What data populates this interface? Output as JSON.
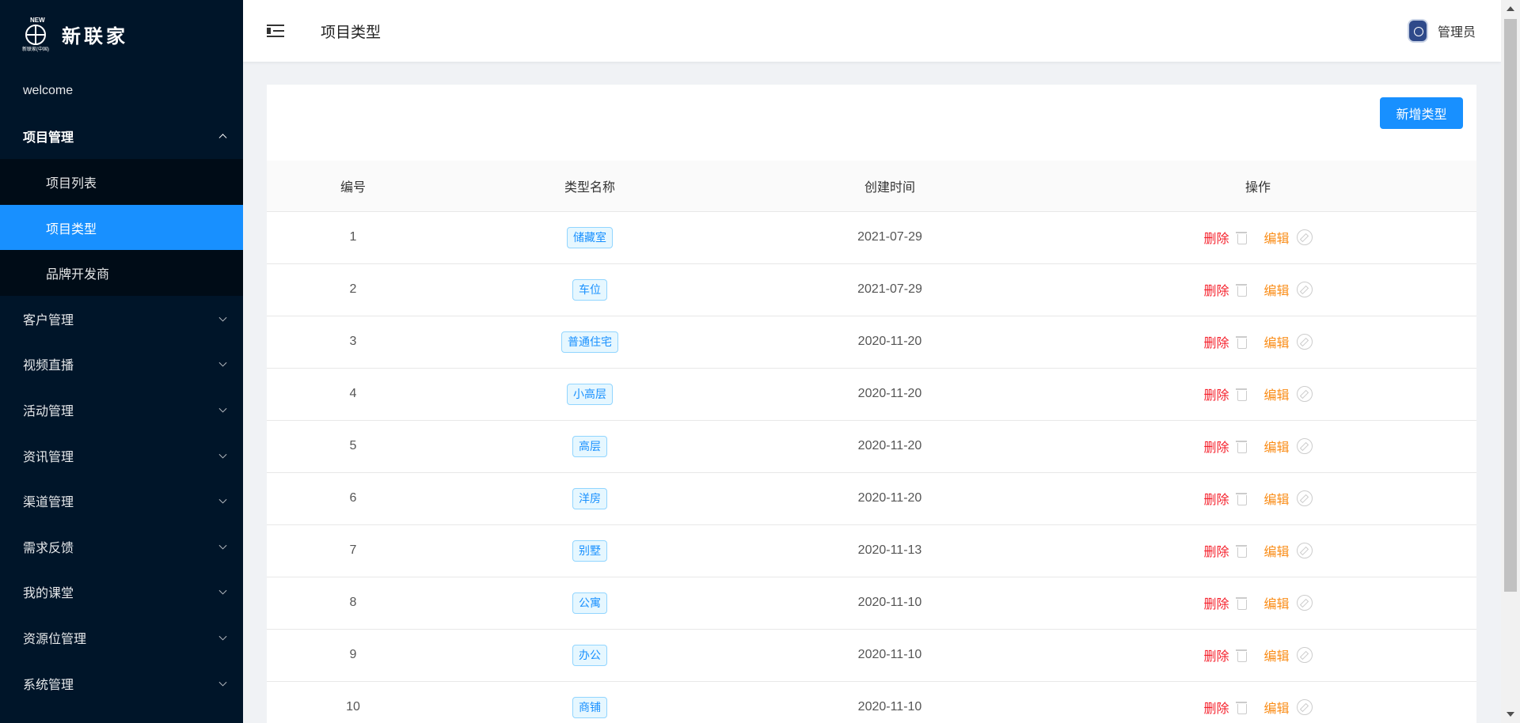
{
  "brand": {
    "logo_new": "NEW",
    "logo_sub": "新联家(中国)",
    "name": "新联家"
  },
  "sidebar": {
    "welcome": "welcome",
    "items": [
      {
        "label": "项目管理",
        "open": true,
        "children": [
          "项目列表",
          "项目类型",
          "品牌开发商"
        ],
        "active_child": "项目类型"
      },
      {
        "label": "客户管理"
      },
      {
        "label": "视频直播"
      },
      {
        "label": "活动管理"
      },
      {
        "label": "资讯管理"
      },
      {
        "label": "渠道管理"
      },
      {
        "label": "需求反馈"
      },
      {
        "label": "我的课堂"
      },
      {
        "label": "资源位管理"
      },
      {
        "label": "系统管理"
      }
    ]
  },
  "header": {
    "title": "项目类型",
    "user": "管理员"
  },
  "toolbar": {
    "add_label": "新增类型"
  },
  "table": {
    "columns": [
      "编号",
      "类型名称",
      "创建时间",
      "操作"
    ],
    "delete_label": "删除",
    "edit_label": "编辑",
    "rows": [
      {
        "id": "1",
        "name": "储藏室",
        "created": "2021-07-29"
      },
      {
        "id": "2",
        "name": "车位",
        "created": "2021-07-29"
      },
      {
        "id": "3",
        "name": "普通住宅",
        "created": "2020-11-20"
      },
      {
        "id": "4",
        "name": "小高层",
        "created": "2020-11-20"
      },
      {
        "id": "5",
        "name": "高层",
        "created": "2020-11-20"
      },
      {
        "id": "6",
        "name": "洋房",
        "created": "2020-11-20"
      },
      {
        "id": "7",
        "name": "别墅",
        "created": "2020-11-13"
      },
      {
        "id": "8",
        "name": "公寓",
        "created": "2020-11-10"
      },
      {
        "id": "9",
        "name": "办公",
        "created": "2020-11-10"
      },
      {
        "id": "10",
        "name": "商铺",
        "created": "2020-11-10"
      }
    ]
  },
  "colors": {
    "sidebar_bg": "#001529",
    "submenu_bg": "#000c17",
    "accent": "#1890ff",
    "delete": "#f5222d",
    "edit": "#fa8c16"
  }
}
